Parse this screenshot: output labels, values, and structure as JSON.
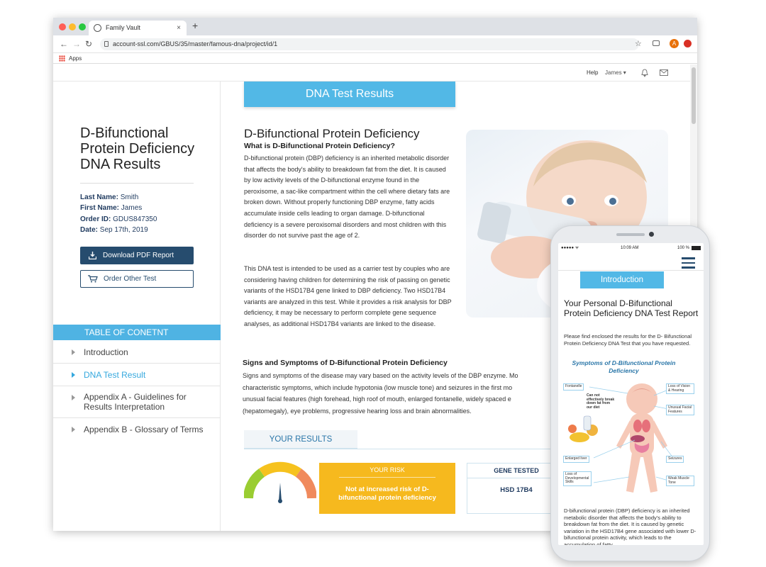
{
  "browser": {
    "tab_title": "Family Vault",
    "tab_close": "×",
    "new_tab": "+",
    "url": "account-ssl.com/GBUS/35/master/famous-dna/project/id/1",
    "bookmarks_apps": "Apps",
    "profile_initial": "A"
  },
  "topnav": {
    "help": "Help",
    "user": "James",
    "caret": "▾"
  },
  "sidebar": {
    "title": "D-Bifunctional Protein Deficiency DNA Results",
    "meta": [
      {
        "label": "Last Name:",
        "value": "Smith"
      },
      {
        "label": "First Name:",
        "value": "James"
      },
      {
        "label": "Order ID:",
        "value": "GDUS847350"
      },
      {
        "label": "Date:",
        "value": "Sep 17th, 2019"
      }
    ],
    "download_label": "Download PDF Report",
    "order_label": "Order Other Test",
    "toc_heading": "TABLE OF CONETNT",
    "toc": [
      {
        "label": "Introduction",
        "active": false
      },
      {
        "label": "DNA Test Result",
        "active": true
      },
      {
        "label": "Appendix A - Guidelines for Results Interpretation",
        "active": false
      },
      {
        "label": "Appendix B - Glossary of Terms",
        "active": false
      }
    ]
  },
  "main": {
    "banner": "DNA Test Results",
    "heading": "D-Bifunctional Protein Deficiency",
    "subheading": "What is D-Bifunctional Protein Deficiency?",
    "para1": "D-bifunctional protein (DBP) deficiency is an inherited metabolic disorder that affects the body's ability to breakdown fat from the diet. It is caused by low activity levels of the D-bifunctional enzyme found in the peroxisome, a sac-like compartment within the cell where dietary fats are broken down. Without properly functioning DBP enzyme, fatty acids accumulate inside cells leading to organ damage. D-bifunctional deficiency is a severe peroxisomal disorders and most children with this disorder do not survive past the age of 2.",
    "para2": "This DNA test is intended to be used as a carrier test by couples who are considering having children for determining the risk of passing on genetic variants of the HSD17B4 gene linked to DBP deficiency. Two HSD17B4 variants are analyzed in this test. While it provides a risk analysis for DBP deficiency, it may be necessary to perform complete gene sequence analyses, as additional HSD17B4 variants are linked to the disease.",
    "signs_heading": "Signs and Symptoms of D-Bifunctional Protein Deficiency",
    "signs_lines": [
      "Signs and symptoms of the disease may vary based on the activity levels of the DBP enzyme. Mo",
      "characteristic symptoms, which include hypotonia (low muscle tone) and seizures in the first mo",
      "unusual facial features (high forehead, high roof of mouth, enlarged fontanelle, widely spaced e",
      "(hepatomegaly), eye problems, progressive hearing loss and brain abnormalities."
    ],
    "results_tab": "YOUR RESULTS",
    "risk_heading": "YOUR RISK",
    "risk_text": "Not at increased risk of D- bifunctional protein deficiency",
    "gene_heading": "GENE TESTED",
    "gene_value": "HSD 17B4"
  },
  "phone": {
    "status_signal": "●●●●● ᯤ",
    "status_time": "10:09 AM",
    "status_battery": "100 %",
    "intro_label": "Introduction",
    "title": "Your Personal D-Bifunctional Protein Deficiency DNA Test Report",
    "intro_text": "Please find enclosed the results for the D- Bifunctional Protein Deficiency DNA Test that you have requested.",
    "diagram_title": "Symptoms of D-Bifunctional Protein Deficiency",
    "diagram_labels": {
      "fontanelle": "Fontanelle",
      "fat": "Can not effectively break down fat from our diet",
      "vision": "Loss of Vision & Hearing",
      "facial": "Unusual Facial Features",
      "liver": "Enlarged liver",
      "seizures": "Seizures",
      "development": "Loss of Developmental Skills",
      "muscle": "Weak Muscle Tone"
    },
    "bottom_text": "D-bifunctional protein (DBP) deficiency is an inherited metabolic disorder that affects the body's ability to breakdown fat from the diet. It is caused by genetic variation in the HSD17B4 gene associated with lower D- bifunctional protein activity, which leads to the accumulation of fatty"
  },
  "colors": {
    "accent": "#52b8e6",
    "navy": "#264c6e",
    "risk": "#f6b91e"
  }
}
